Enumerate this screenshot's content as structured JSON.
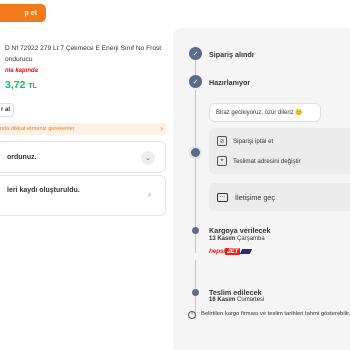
{
  "header": {
    "track_button": "p et"
  },
  "product": {
    "title_line1": "D Nf 72922 279 Lt 7 Çekmece E Enerji Sınıf No Frost",
    "title_line2": "ondurucu",
    "campaign": "nla kapında",
    "price": "3,72",
    "currency": "TL"
  },
  "actions": {
    "small_button": "r al"
  },
  "notice": {
    "text": "nda dikkat etmeniz gerekenler",
    "chevron": "›"
  },
  "cards": [
    {
      "text": "ordunuz.",
      "chevron": "⌄"
    },
    {
      "text": "leri kaydı oluşturuldu.",
      "chevron": "›"
    }
  ],
  "timeline": {
    "steps": [
      {
        "title": "Sipariş alındı"
      },
      {
        "title": "Hazırlanıyor"
      },
      {
        "title": "Kargoya verilecek",
        "date": "13 Kasım",
        "day": "Çarşamba"
      },
      {
        "title": "Teslim edilecek",
        "date": "16 Kasım",
        "day": "Cumartesi"
      }
    ],
    "message": "Biraz gecikiyoruz, özür dileriz 😊",
    "cancel_label": "Siparişi iptal et",
    "address_label": "Teslimat adresini değiştir",
    "contact_label": "İletişime geç",
    "carrier": {
      "brand": "hepsi",
      "brand_jet": "JET"
    },
    "info_note": "Belirtilen kargo firması ve teslim tarihleri tahmi gösterebilir."
  },
  "icons": {
    "check": "✓",
    "cancel": "⊘",
    "map": "⌖",
    "chat": "…",
    "info": "i"
  },
  "colors": {
    "accent": "#f27a1a",
    "price": "#0bc15c",
    "campaign": "#d21312",
    "timeline": "#5c6b8a"
  }
}
